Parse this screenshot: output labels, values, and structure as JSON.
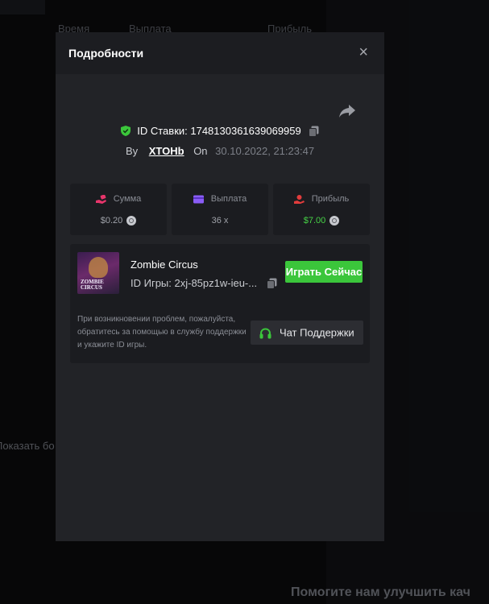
{
  "background": {
    "table_headers": [
      "Время",
      "Выплата",
      "Прибыль"
    ],
    "show_more": "Показать бо",
    "help_banner": "Помогите нам улучшить кач"
  },
  "modal": {
    "title": "Подробности",
    "close_label": "×",
    "bet_id_label": "ID Ставки: 1748130361639069959",
    "by_label": "By",
    "username": "XTOHb",
    "on_label": "On",
    "datetime": "30.10.2022, 21:23:47",
    "stats": {
      "amount": {
        "label": "Сумма",
        "value": "$0.20",
        "icon": "money-hand-icon",
        "color": "#e8356b"
      },
      "payout": {
        "label": "Выплата",
        "value": "36 x",
        "icon": "card-icon",
        "color": "#8a5cf6"
      },
      "profit": {
        "label": "Прибыль",
        "value": "$7.00",
        "icon": "profit-hand-icon",
        "color": "#e23c3c",
        "value_color": "#46d246"
      }
    },
    "game": {
      "name": "Zombie Circus",
      "thumb_text_1": "ZOMBIE",
      "thumb_text_2": "CIRCUS",
      "id_label": "ID Игры: 2xj-85pz1w-ieu-...",
      "play_label": "Играть Сейчас"
    },
    "help_text": "При возникновении проблем, пожалуйста, обратитесь за помощью в службу поддержки и укажите ID игры.",
    "support_label": "Чат Поддержки"
  },
  "colors": {
    "accent_green": "#3bc63b",
    "modal_bg": "#222327",
    "card_bg": "#1b1c20"
  }
}
